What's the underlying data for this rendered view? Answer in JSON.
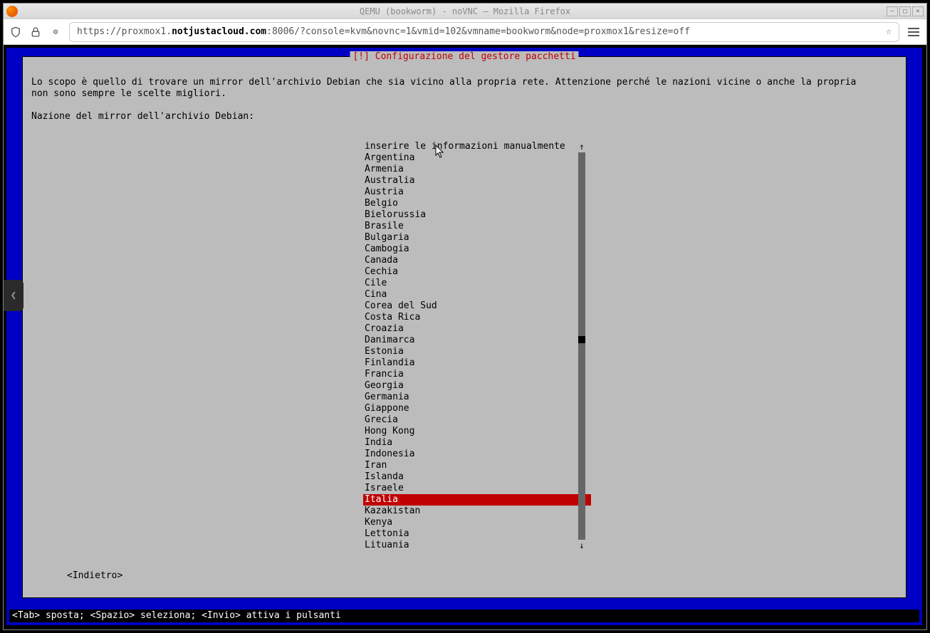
{
  "window": {
    "title": "QEMU (bookworm) - noVNC – Mozilla Firefox"
  },
  "urlbar": {
    "prefix": "https://proxmox1.",
    "host": "notjustacloud.com",
    "suffix": ":8006/?console=kvm&novnc=1&vmid=102&vmname=bookworm&node=proxmox1&resize=off"
  },
  "installer": {
    "title": "[!] Configurazione del gestore pacchetti",
    "description": "Lo scopo è quello di trovare un mirror dell'archivio Debian che sia vicino alla propria rete. Attenzione perché le nazioni vicine o anche la propria\nnon sono sempre le scelte migliori.",
    "prompt": "Nazione del mirror dell'archivio Debian:",
    "back_label": "<Indietro>",
    "items": [
      "inserire le informazioni manualmente",
      "Argentina",
      "Armenia",
      "Australia",
      "Austria",
      "Belgio",
      "Bielorussia",
      "Brasile",
      "Bulgaria",
      "Cambogia",
      "Canada",
      "Cechia",
      "Cile",
      "Cina",
      "Corea del Sud",
      "Costa Rica",
      "Croazia",
      "Danimarca",
      "Estonia",
      "Finlandia",
      "Francia",
      "Georgia",
      "Germania",
      "Giappone",
      "Grecia",
      "Hong Kong",
      "India",
      "Indonesia",
      "Iran",
      "Islanda",
      "Israele",
      "Italia",
      "Kazakistan",
      "Kenya",
      "Lettonia",
      "Lituania"
    ],
    "selected_index": 31,
    "bottom_help": "<Tab> sposta; <Spazio> seleziona; <Invio> attiva i pulsanti"
  }
}
